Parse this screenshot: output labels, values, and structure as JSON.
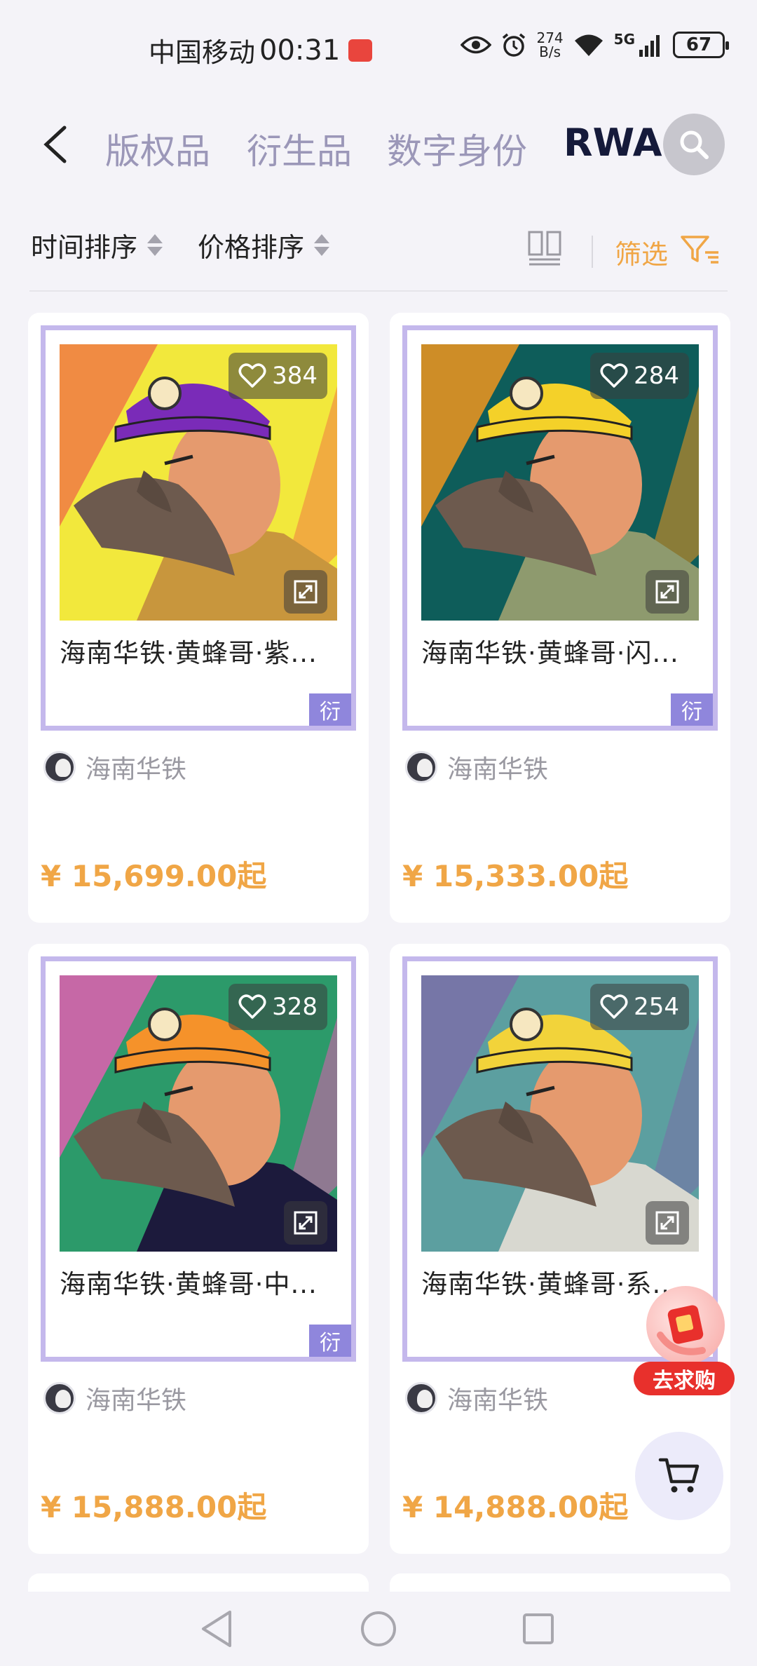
{
  "status_bar": {
    "carrier": "中国移动",
    "time": "00:31",
    "net_speed_value": "274",
    "net_speed_unit": "B/s",
    "signal_label": "5G",
    "battery": "67"
  },
  "tabs": [
    {
      "label": "版权品",
      "active": false
    },
    {
      "label": "衍生品",
      "active": false
    },
    {
      "label": "数字身份",
      "active": false
    },
    {
      "label": "RWA",
      "active": true
    }
  ],
  "sort_bar": {
    "time_sort": "时间排序",
    "price_sort": "价格排序",
    "filter": "筛选"
  },
  "products": [
    {
      "title": "海南华铁·黄蜂哥·紫...",
      "likes": "384",
      "creator": "海南华铁",
      "price": "¥ 15,699.00起",
      "tag": "衍",
      "helmet": "#7a2bb8",
      "bg": "#f2e83c",
      "bg2": "#f07a44",
      "shirt": "#c8963d"
    },
    {
      "title": "海南华铁·黄蜂哥·闪...",
      "likes": "284",
      "creator": "海南华铁",
      "price": "¥ 15,333.00起",
      "tag": "衍",
      "helmet": "#f4d129",
      "bg": "#0e5d5a",
      "bg2": "#f0951e",
      "shirt": "#8e9a6e"
    },
    {
      "title": "海南华铁·黄蜂哥·中...",
      "likes": "328",
      "creator": "海南华铁",
      "price": "¥ 15,888.00起",
      "tag": "衍",
      "helmet": "#f5922a",
      "bg": "#2c9a6a",
      "bg2": "#e25fb0",
      "shirt": "#1c1a3c"
    },
    {
      "title": "海南华铁·黄蜂哥·系...",
      "likes": "254",
      "creator": "海南华铁",
      "price": "¥ 14,888.00起",
      "tag": "",
      "helmet": "#f2d33a",
      "bg": "#5c9fa0",
      "bg2": "#7a6ea8",
      "shirt": "#d8d8d0"
    }
  ],
  "floating": {
    "promo_label": "去求购"
  }
}
